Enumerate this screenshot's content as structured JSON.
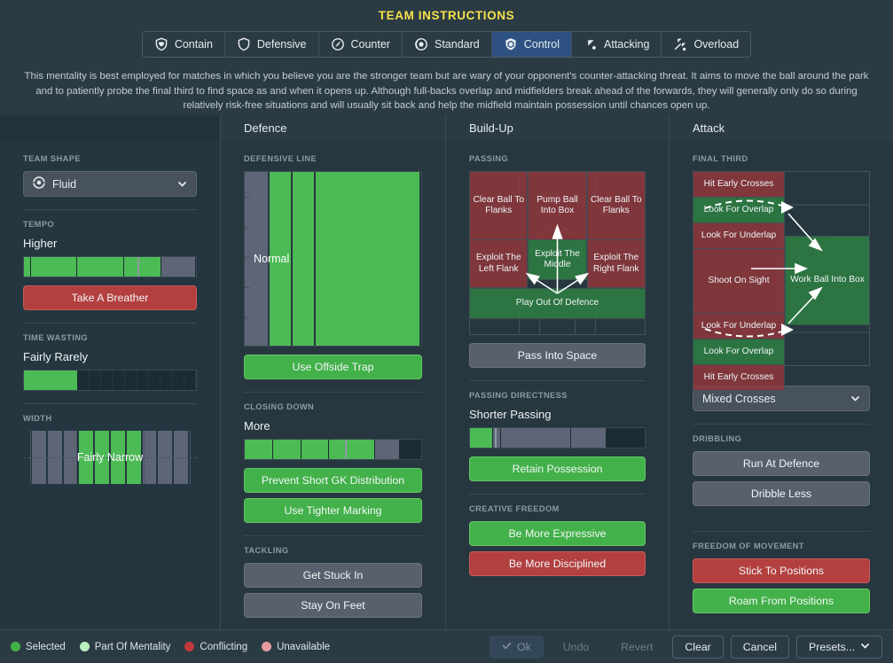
{
  "header": {
    "title": "TEAM INSTRUCTIONS",
    "mentality_tabs": [
      {
        "label": "Contain",
        "icon": "shield-contain-icon",
        "selected": false
      },
      {
        "label": "Defensive",
        "icon": "shield-defensive-icon",
        "selected": false
      },
      {
        "label": "Counter",
        "icon": "shield-counter-icon",
        "selected": false
      },
      {
        "label": "Standard",
        "icon": "shield-standard-icon",
        "selected": false
      },
      {
        "label": "Control",
        "icon": "shield-control-icon",
        "selected": true
      },
      {
        "label": "Attacking",
        "icon": "arrow-attacking-icon",
        "selected": false
      },
      {
        "label": "Overload",
        "icon": "arrows-overload-icon",
        "selected": false
      }
    ],
    "description": "This mentality is best employed for matches in which you believe you are the stronger team but are wary of your opponent's counter-attacking threat. It aims to move the ball around the park and to patiently probe the final third to find space as and when it opens up. Although full-backs overlap and midfielders break ahead of the forwards, they will generally only do so during relatively risk-free situations and will usually sit back and help the midfield maintain possession until chances open up."
  },
  "sidebar": {
    "team_shape": {
      "label": "TEAM SHAPE",
      "value": "Fluid",
      "icon": "fluid-shape-icon"
    },
    "tempo": {
      "label": "TEMPO",
      "value": "Higher",
      "segments": [
        "g",
        "g",
        "g",
        "g",
        "m"
      ],
      "marker_percent": 66
    },
    "take_a_breather": {
      "label": "Take A Breather",
      "state": "conflicting"
    },
    "time_wasting": {
      "label": "TIME WASTING",
      "value": "Fairly Rarely",
      "fill_percent": 31,
      "tick_count": 10
    },
    "width": {
      "label": "WIDTH",
      "value": "Fairly Narrow",
      "bars": [
        "m",
        "m",
        "m",
        "g",
        "g",
        "g",
        "g",
        "m",
        "m",
        "m"
      ]
    }
  },
  "columns": {
    "defence": {
      "title": "Defence",
      "defensive_line": {
        "label": "DEFENSIVE LINE",
        "value": "Normal",
        "columns": [
          {
            "state": "g",
            "width": 60
          },
          {
            "state": "g",
            "width": 13
          },
          {
            "state": "g",
            "width": 13
          },
          {
            "state": "m",
            "width": 14
          }
        ]
      },
      "use_offside_trap": {
        "label": "Use Offside Trap",
        "state": "selected"
      },
      "closing_down": {
        "label": "CLOSING DOWN",
        "value": "More",
        "segments": [
          "g",
          "g",
          "g",
          "g",
          "m",
          "e"
        ],
        "marker_percent": 57
      },
      "prevent_short_gk": {
        "label": "Prevent Short GK Distribution",
        "state": "selected"
      },
      "use_tighter_marking": {
        "label": "Use Tighter Marking",
        "state": "selected"
      },
      "tackling": {
        "label": "TACKLING",
        "options": [
          {
            "label": "Get Stuck In",
            "state": "neutral"
          },
          {
            "label": "Stay On Feet",
            "state": "neutral"
          }
        ]
      }
    },
    "build_up": {
      "title": "Build-Up",
      "passing": {
        "label": "PASSING",
        "cells": [
          {
            "label": "Clear Ball To Flanks",
            "state": "red",
            "name": "clear-ball-to-flanks-left"
          },
          {
            "label": "Pump Ball Into Box",
            "state": "red",
            "name": "pump-ball-into-box"
          },
          {
            "label": "Clear Ball To Flanks",
            "state": "red",
            "name": "clear-ball-to-flanks-right"
          },
          {
            "label": "Exploit The Left Flank",
            "state": "red",
            "name": "exploit-the-left-flank"
          },
          {
            "label": "Exploit The Middle",
            "state": "green",
            "name": "exploit-the-middle"
          },
          {
            "label": "Exploit The Right Flank",
            "state": "red",
            "name": "exploit-the-right-flank"
          },
          {
            "label": "Play Out Of Defence",
            "state": "green",
            "name": "play-out-of-defence"
          }
        ]
      },
      "pass_into_space": {
        "label": "Pass Into Space",
        "state": "neutral"
      },
      "passing_directness": {
        "label": "PASSING DIRECTNESS",
        "value": "Shorter Passing",
        "segments": [
          "g",
          "m",
          "m",
          "m",
          "e"
        ],
        "marker_percent": 14
      },
      "retain_possession": {
        "label": "Retain Possession",
        "state": "selected"
      },
      "creative_freedom": {
        "label": "CREATIVE FREEDOM",
        "options": [
          {
            "label": "Be More Expressive",
            "state": "selected"
          },
          {
            "label": "Be More Disciplined",
            "state": "conflicting"
          }
        ]
      }
    },
    "attack": {
      "title": "Attack",
      "final_third": {
        "label": "FINAL THIRD",
        "cells": [
          {
            "label": "Hit Early Crosses",
            "state": "red",
            "name": "hit-early-crosses-top"
          },
          {
            "label": "Look For Overlap",
            "state": "green",
            "name": "look-for-overlap-top"
          },
          {
            "label": "Look For Underlap",
            "state": "red",
            "name": "look-for-underlap-top"
          },
          {
            "label": "Shoot On Sight",
            "state": "red",
            "name": "shoot-on-sight"
          },
          {
            "label": "Look For Underlap",
            "state": "red",
            "name": "look-for-underlap-bottom"
          },
          {
            "label": "Look For Overlap",
            "state": "green",
            "name": "look-for-overlap-bottom"
          },
          {
            "label": "Hit Early Crosses",
            "state": "red",
            "name": "hit-early-crosses-bottom"
          },
          {
            "label": "Work Ball Into Box",
            "state": "green",
            "name": "work-ball-into-box"
          }
        ]
      },
      "crosses": {
        "value": "Mixed Crosses",
        "icon": "chevron-down-icon"
      },
      "dribbling": {
        "label": "DRIBBLING",
        "options": [
          {
            "label": "Run At Defence",
            "state": "neutral"
          },
          {
            "label": "Dribble Less",
            "state": "neutral"
          }
        ]
      },
      "freedom_of_movement": {
        "label": "FREEDOM OF MOVEMENT",
        "options": [
          {
            "label": "Stick To Positions",
            "state": "conflicting"
          },
          {
            "label": "Roam From Positions",
            "state": "selected"
          }
        ]
      }
    }
  },
  "footer": {
    "legend": [
      {
        "label": "Selected",
        "color": "#43b149"
      },
      {
        "label": "Part Of Mentality",
        "color": "#b9efbd"
      },
      {
        "label": "Conflicting",
        "color": "#c0383c"
      },
      {
        "label": "Unavailable",
        "color": "#e79a9e"
      }
    ],
    "buttons": [
      {
        "label": "Ok",
        "state": "ok",
        "icon": "check-icon"
      },
      {
        "label": "Undo",
        "state": "disabled"
      },
      {
        "label": "Revert",
        "state": "disabled"
      },
      {
        "label": "Clear",
        "state": "normal"
      },
      {
        "label": "Cancel",
        "state": "normal"
      },
      {
        "label": "Presets...",
        "state": "normal",
        "icon": "chevron-down-icon"
      }
    ]
  },
  "colors": {
    "background": "#27373f",
    "panel": "#2b3b44",
    "sidebar": "#243740",
    "accent_title": "#f5e14b",
    "tab_selected": "#2d5180",
    "green": "#43b149",
    "red": "#b33f3f",
    "neutral": "#58606e"
  }
}
